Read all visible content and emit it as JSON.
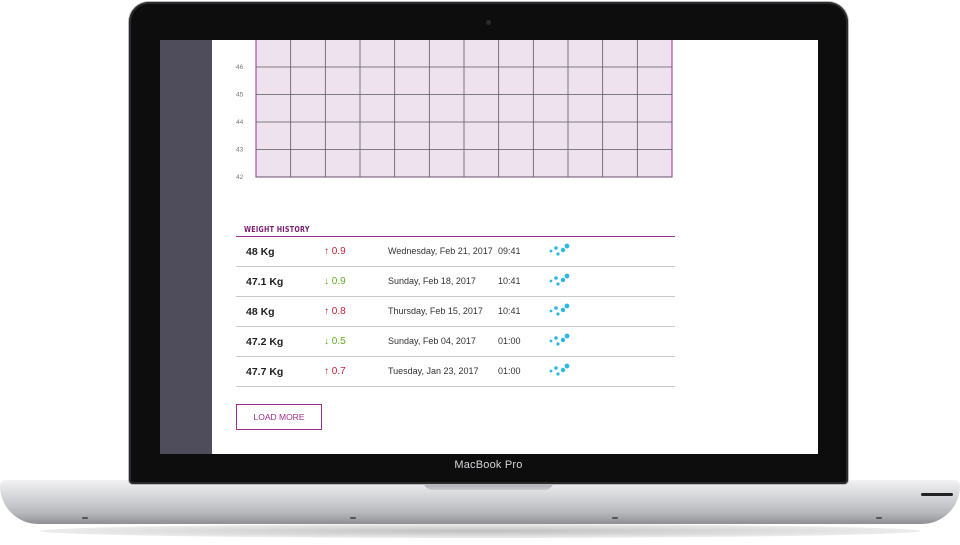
{
  "device": {
    "label": "MacBook Pro"
  },
  "chart_data": {
    "type": "line",
    "y_ticks": [
      "46",
      "45",
      "44",
      "43",
      "42"
    ],
    "ylim": [
      42,
      47
    ],
    "columns": 12,
    "grid": true,
    "colors": {
      "fill": "#efe2ef",
      "border": "#9d2f8b",
      "grid": "#5a5a5e"
    }
  },
  "history": {
    "title": "WEIGHT HISTORY",
    "rows": [
      {
        "weight": "48 Kg",
        "delta": "0.9",
        "direction": "up",
        "date": "Wednesday, Feb 21, 2017",
        "time": "09:41"
      },
      {
        "weight": "47.1 Kg",
        "delta": "0.9",
        "direction": "down",
        "date": "Sunday, Feb 18, 2017",
        "time": "10:41"
      },
      {
        "weight": "48 Kg",
        "delta": "0.8",
        "direction": "up",
        "date": "Thursday, Feb 15, 2017",
        "time": "10:41"
      },
      {
        "weight": "47.2 Kg",
        "delta": "0.5",
        "direction": "down",
        "date": "Sunday, Feb 04, 2017",
        "time": "01:00"
      },
      {
        "weight": "47.7 Kg",
        "delta": "0.7",
        "direction": "up",
        "date": "Tuesday, Jan 23, 2017",
        "time": "01:00"
      }
    ],
    "source_icon": "device-dots-icon",
    "colors": {
      "up": "#c4213b",
      "down": "#5fae1f",
      "icon": "#2bb6e4"
    }
  },
  "actions": {
    "load_more": "LOAD MORE"
  }
}
